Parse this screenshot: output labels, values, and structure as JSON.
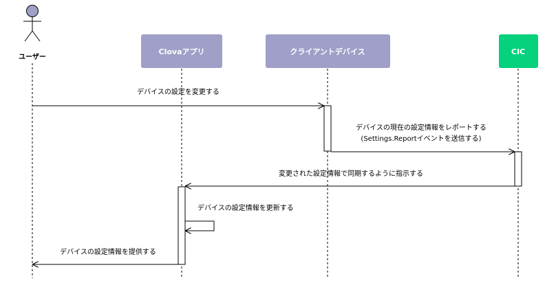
{
  "participants": {
    "user": {
      "label": "ユーザー",
      "type": "actor"
    },
    "clova_app": {
      "label": "Clovaアプリ",
      "color": "#a09fc8"
    },
    "client_device": {
      "label": "クライアントデバイス",
      "color": "#a09fc8"
    },
    "cic": {
      "label": "CIC",
      "color": "#06d17c"
    }
  },
  "messages": {
    "m1": {
      "text": "デバイスの設定を変更する"
    },
    "m2": {
      "line1": "デバイスの現在の設定情報をレポートする",
      "line2": "(Settings.Reportイベントを送信する)"
    },
    "m3": {
      "text": "変更された設定情報で同期するように指示する"
    },
    "m4": {
      "text": "デバイスの設定情報を更新する"
    },
    "m5": {
      "text": "デバイスの設定情報を提供する"
    }
  },
  "colors": {
    "actor_fill": "#a09fc8",
    "participant_text": "#ffffff",
    "line": "#000000"
  }
}
